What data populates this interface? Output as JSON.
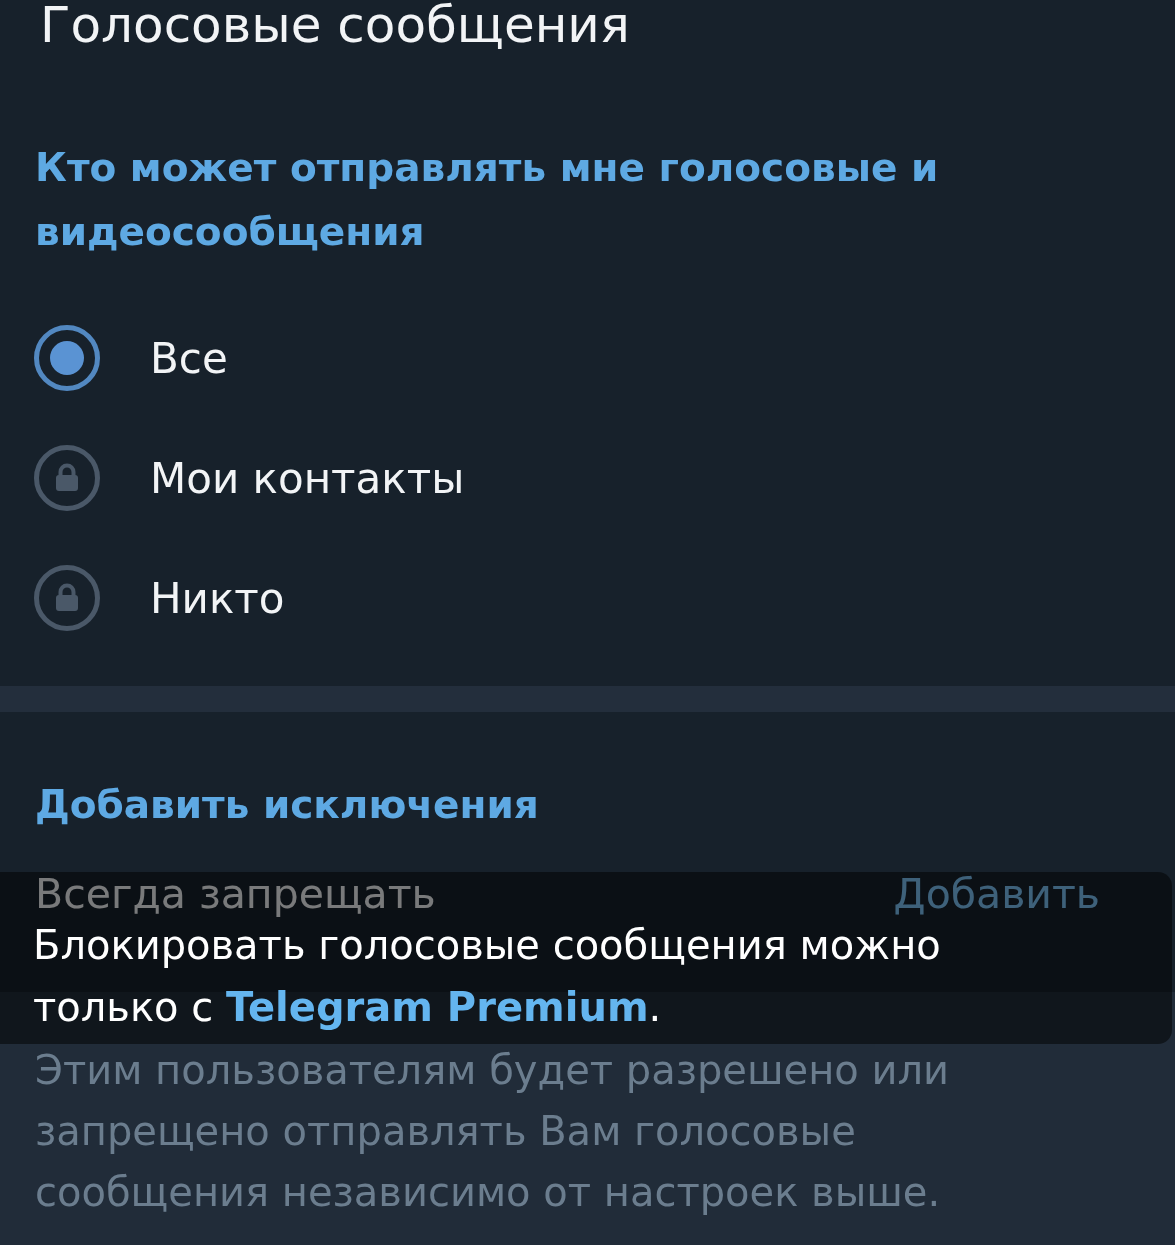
{
  "header": {
    "title": "Голосовые сообщения"
  },
  "privacy_section": {
    "heading": "Кто может отправлять мне голосовые и видеосообщения",
    "options": [
      {
        "label": "Все",
        "selected": true,
        "locked": false
      },
      {
        "label": "Мои контакты",
        "selected": false,
        "locked": true
      },
      {
        "label": "Никто",
        "selected": false,
        "locked": true
      }
    ]
  },
  "exceptions_section": {
    "heading": "Добавить исключения",
    "rows": [
      {
        "label": "Всегда запрещать",
        "action": "Добавить"
      }
    ],
    "footer": "Этим пользователям будет разрешено или запрещено отправлять Вам голосовые сообщения независимо от настроек выше."
  },
  "toast": {
    "text": "Блокировать голосовые сообщения можно только с ",
    "link": "Telegram Premium",
    "text_end": "."
  }
}
